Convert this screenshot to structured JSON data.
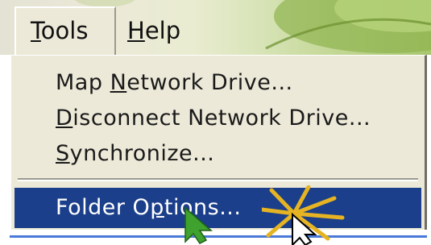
{
  "menubar": {
    "tools": {
      "label_pre": "",
      "label_ul": "T",
      "label_post": "ools"
    },
    "help": {
      "label_pre": "",
      "label_ul": "H",
      "label_post": "elp"
    }
  },
  "dropdown": {
    "items": [
      {
        "pre": "Map ",
        "ul": "N",
        "post": "etwork Drive..."
      },
      {
        "pre": "",
        "ul": "D",
        "post": "isconnect Network Drive..."
      },
      {
        "pre": "",
        "ul": "S",
        "post": "ynchronize..."
      },
      {
        "pre": "Folder O",
        "ul": "p",
        "post": "tions..."
      }
    ],
    "highlighted_index": 3,
    "highlight_color": "#1b3f8a"
  },
  "icons": {
    "cursor": "mouse-pointer-icon",
    "click_burst": "click-highlight-icon",
    "arrow": "green-arrow-icon"
  }
}
